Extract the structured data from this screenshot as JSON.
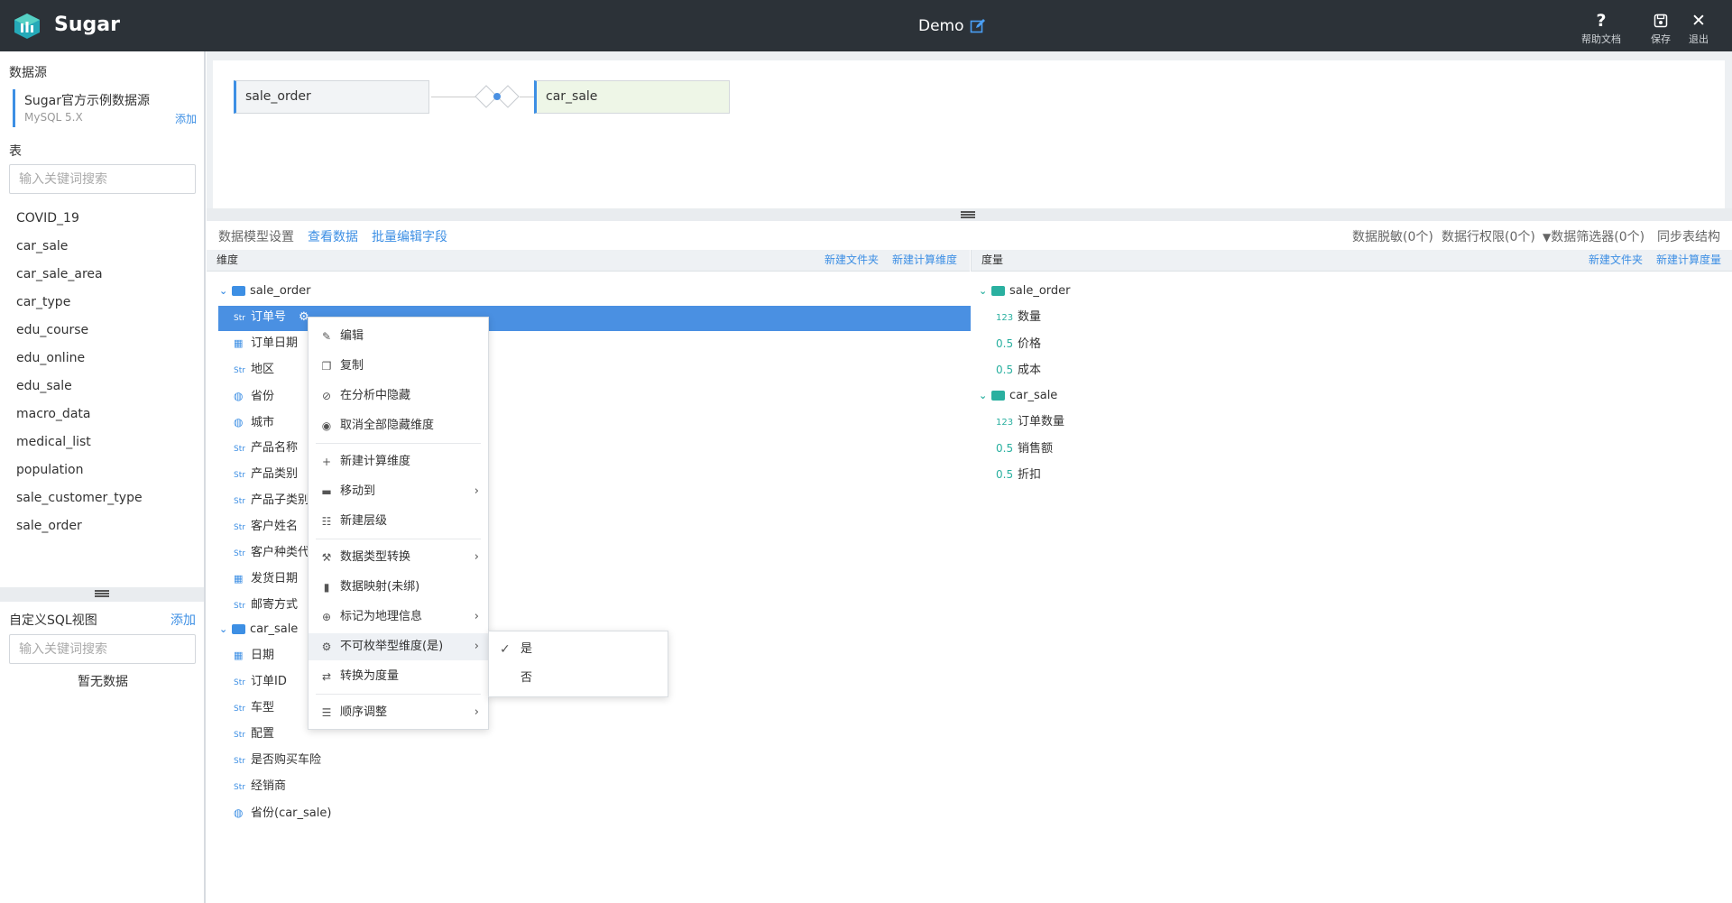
{
  "header": {
    "brand": "Sugar",
    "title": "Demo",
    "help_label": "帮助文档",
    "save_label": "保存",
    "exit_label": "退出"
  },
  "sidebar": {
    "datasource_title": "数据源",
    "datasource_name": "Sugar官方示例数据源",
    "datasource_type": "MySQL 5.X",
    "datasource_add": "添加",
    "tables_title": "表",
    "table_search_placeholder": "输入关键词搜索",
    "tables": [
      "COVID_19",
      "car_sale",
      "car_sale_area",
      "car_type",
      "edu_course",
      "edu_online",
      "edu_sale",
      "macro_data",
      "medical_list",
      "population",
      "sale_customer_type",
      "sale_order"
    ],
    "sql_title": "自定义SQL视图",
    "sql_add": "添加",
    "sql_search_placeholder": "输入关键词搜索",
    "sql_empty": "暂无数据"
  },
  "model": {
    "left_table": "sale_order",
    "right_table": "car_sale"
  },
  "toolbar": {
    "settings": "数据模型设置",
    "view_data": "查看数据",
    "batch_edit": "批量编辑字段",
    "masking": "数据脱敏(0个)",
    "row_perm": "数据行权限(0个)",
    "filter": "数据筛选器(0个)",
    "sync": "同步表结构"
  },
  "dimensions": {
    "title": "维度",
    "new_folder": "新建文件夹",
    "new_calc": "新建计算维度",
    "groups": [
      {
        "name": "sale_order",
        "fields": [
          {
            "type": "Str",
            "name": "订单号"
          },
          {
            "type": "cal",
            "name": "订单日期"
          },
          {
            "type": "Str",
            "name": "地区"
          },
          {
            "type": "geo",
            "name": "省份"
          },
          {
            "type": "geo",
            "name": "城市"
          },
          {
            "type": "Str",
            "name": "产品名称"
          },
          {
            "type": "Str",
            "name": "产品类别"
          },
          {
            "type": "Str",
            "name": "产品子类别"
          },
          {
            "type": "Str",
            "name": "客户姓名"
          },
          {
            "type": "Str",
            "name": "客户种类代"
          },
          {
            "type": "cal",
            "name": "发货日期"
          },
          {
            "type": "Str",
            "name": "邮寄方式"
          }
        ]
      },
      {
        "name": "car_sale",
        "fields": [
          {
            "type": "cal",
            "name": "日期"
          },
          {
            "type": "Str",
            "name": "订单ID"
          },
          {
            "type": "Str",
            "name": "车型"
          },
          {
            "type": "Str",
            "name": "配置"
          },
          {
            "type": "Str",
            "name": "是否购买车险"
          },
          {
            "type": "Str",
            "name": "经销商"
          },
          {
            "type": "geo",
            "name": "省份(car_sale)"
          }
        ]
      }
    ]
  },
  "measures": {
    "title": "度量",
    "new_folder": "新建文件夹",
    "new_calc": "新建计算度量",
    "groups": [
      {
        "name": "sale_order",
        "fields": [
          {
            "type": "123",
            "name": "数量"
          },
          {
            "type": "0.5",
            "name": "价格"
          },
          {
            "type": "0.5",
            "name": "成本"
          }
        ]
      },
      {
        "name": "car_sale",
        "fields": [
          {
            "type": "123",
            "name": "订单数量"
          },
          {
            "type": "0.5",
            "name": "销售额"
          },
          {
            "type": "0.5",
            "name": "折扣"
          }
        ]
      }
    ]
  },
  "context_menu": {
    "edit": "编辑",
    "copy": "复制",
    "hide": "在分析中隐藏",
    "unhide_all": "取消全部隐藏维度",
    "new_calc_dim": "新建计算维度",
    "move_to": "移动到",
    "new_level": "新建层级",
    "type_convert": "数据类型转换",
    "mapping": "数据映射(未绑)",
    "geo": "标记为地理信息",
    "non_enum": "不可枚举型维度(是)",
    "to_measure": "转换为度量",
    "order": "顺序调整"
  },
  "submenu": {
    "yes": "是",
    "no": "否"
  },
  "colors": {
    "header_bg": "#2c3238",
    "accent": "#3d8fe4",
    "selected_row": "#4a90e2",
    "measure_icon": "#2ab0a0",
    "folder_dim": "#3d8fe4",
    "folder_measure": "#2ab0a0"
  }
}
